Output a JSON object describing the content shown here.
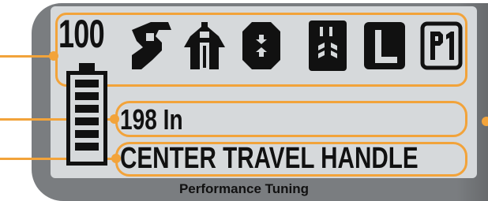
{
  "screen": {
    "battery_value": "100",
    "distance": "198 In",
    "mode": "CENTER  TRAVEL  HANDLE",
    "footer": "Performance Tuning",
    "battery": {
      "level_fraction": 1.0,
      "bars": 6
    }
  },
  "icons": [
    "wrench-icon",
    "caliper-icon",
    "roller-icon",
    "spring-icon",
    "corner-icon",
    "p1-icon"
  ],
  "p1_label": "P1",
  "colors": {
    "accent": "#f2a33a",
    "lcd_bg": "#d6d9db",
    "shell": "#7a7d80",
    "ink": "#111111"
  }
}
